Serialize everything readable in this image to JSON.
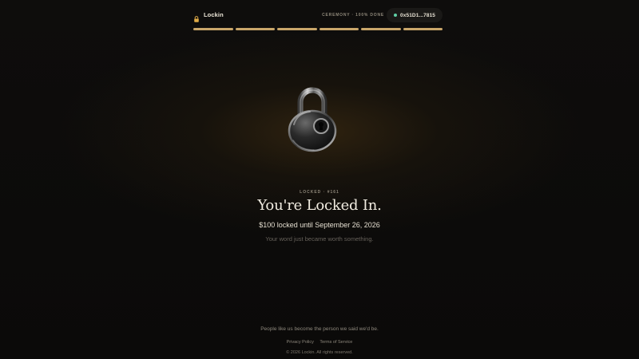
{
  "header": {
    "brand_name": "Lockin",
    "brand_icon": "padlock-icon",
    "ceremony_status": "CEREMONY · 100% DONE",
    "wallet_address": "0x51D1...7815",
    "wallet_status_color": "#5fd0a6"
  },
  "progress": {
    "steps_total": 6,
    "steps_complete": 6,
    "fill_color": "#c9a66a"
  },
  "hero": {
    "image": "padlock-illustration",
    "locked_label": "LOCKED · #161",
    "title": "You're Locked In.",
    "subtitle": "$100 locked until September 26, 2026",
    "tagline": "Your word just became worth something."
  },
  "footer": {
    "quote": "People like us become the person we said we'd be.",
    "links": [
      "Privacy Policy",
      "Terms of Service"
    ],
    "copyright": "© 2026 Lockin. All rights reserved."
  },
  "colors": {
    "background": "#0b0a09",
    "accent": "#c9a66a",
    "glow": "#4a3412"
  }
}
